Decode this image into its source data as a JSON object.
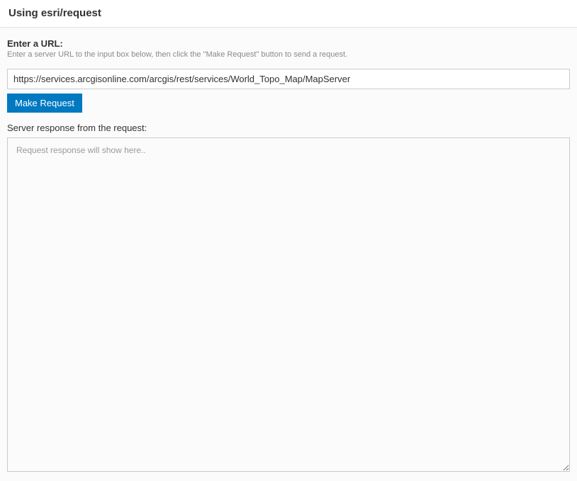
{
  "header": {
    "title": "Using esri/request"
  },
  "form": {
    "url_label": "Enter a URL:",
    "url_hint": "Enter a server URL to the input box below, then click the \"Make Request\" button to send a request.",
    "url_value": "https://services.arcgisonline.com/arcgis/rest/services/World_Topo_Map/MapServer",
    "make_request_label": "Make Request",
    "response_label": "Server response from the request:",
    "response_placeholder": "Request response will show here..",
    "response_value": ""
  }
}
